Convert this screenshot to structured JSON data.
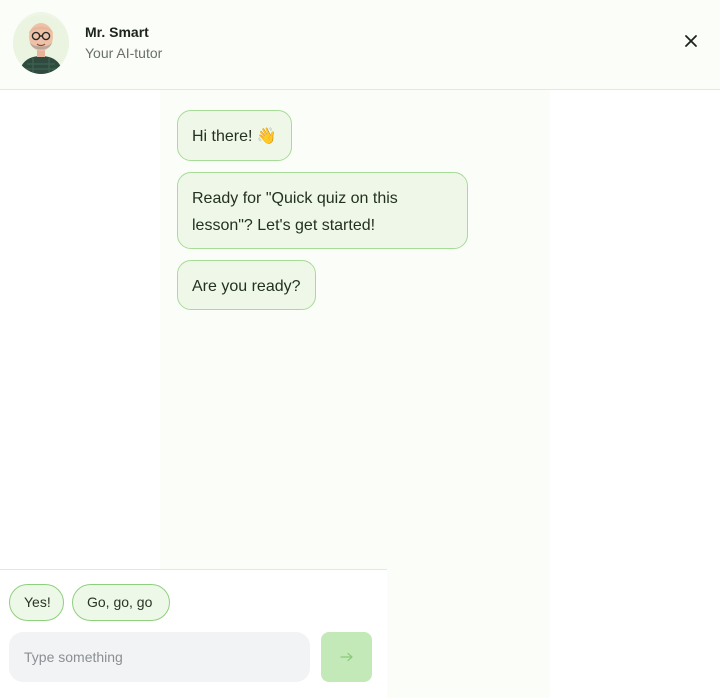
{
  "header": {
    "tutor_name": "Mr. Smart",
    "tutor_subtitle": "Your AI-tutor",
    "close_icon": "close-icon",
    "avatar_icon": "tutor-avatar"
  },
  "messages": [
    {
      "text": "Hi there! 👋"
    },
    {
      "text": "Ready for \"Quick quiz on this lesson\"? Let's get started!"
    },
    {
      "text": "Are you ready?"
    }
  ],
  "quick_replies": [
    {
      "label": "Yes!"
    },
    {
      "label": "Go, go, go"
    }
  ],
  "composer": {
    "placeholder": "Type something",
    "value": "",
    "send_icon": "arrow-right-icon"
  },
  "colors": {
    "accent": "#a6dc97",
    "bubble_bg": "#eff8e8",
    "send_button": "#c4e9b8",
    "header_bg": "#fbfdf8"
  }
}
